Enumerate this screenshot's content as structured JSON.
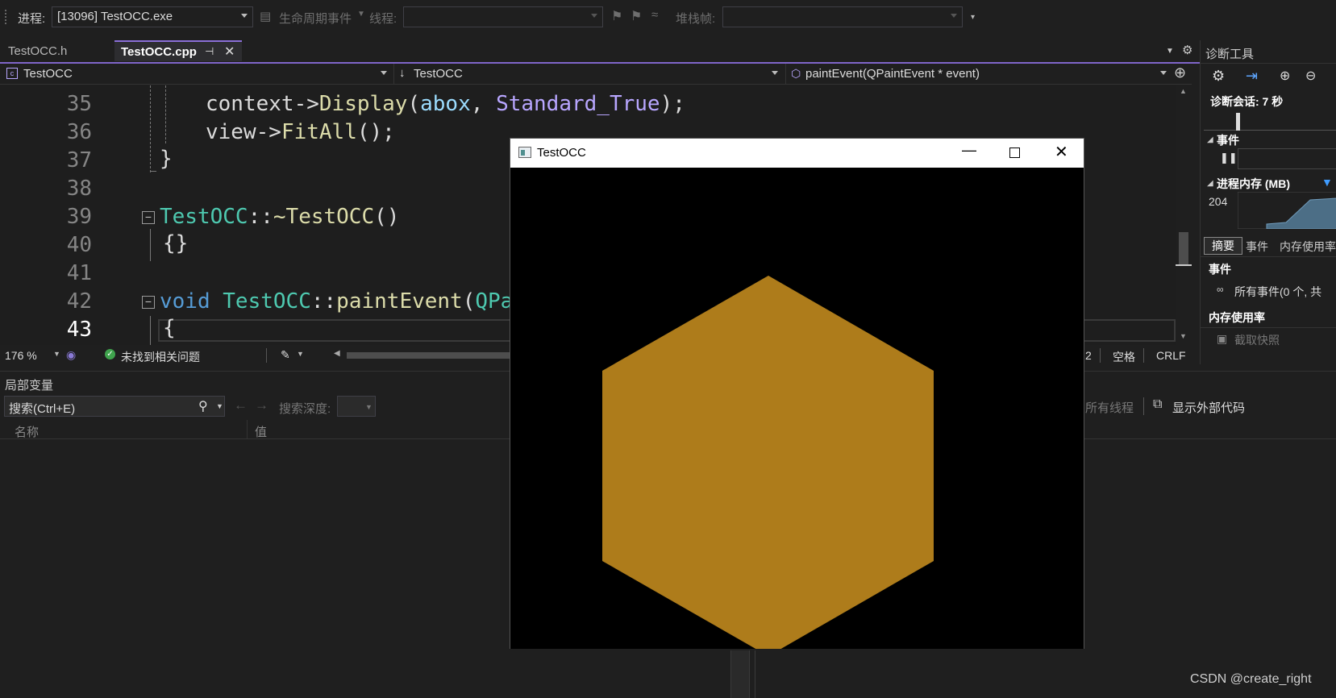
{
  "toolbar": {
    "process_label": "进程:",
    "process_value": "[13096] TestOCC.exe",
    "lifecycle_label": "生命周期事件",
    "thread_label": "线程:",
    "stackframe_label": "堆栈帧:"
  },
  "tabs": [
    {
      "label": "TestOCC.h"
    },
    {
      "label": "TestOCC.cpp"
    }
  ],
  "navbar": {
    "scope": "TestOCC",
    "member_scope": "TestOCC",
    "function": "paintEvent(QPaintEvent * event)"
  },
  "editor": {
    "lines": [
      {
        "num": "35",
        "text": "context->Display(abox, Standard_True);"
      },
      {
        "num": "36",
        "text": "view->FitAll();"
      },
      {
        "num": "37",
        "text": "}"
      },
      {
        "num": "38",
        "text": ""
      },
      {
        "num": "39",
        "text": "TestOCC::~TestOCC()"
      },
      {
        "num": "40",
        "text": "{}"
      },
      {
        "num": "41",
        "text": ""
      },
      {
        "num": "42",
        "text": "void TestOCC::paintEvent(QPaint"
      },
      {
        "num": "43",
        "text": "{"
      }
    ],
    "tokens": {
      "l35_a": "context",
      "l35_b": "->",
      "l35_c": "Display",
      "l35_d": "(",
      "l35_e": "abox",
      "l35_f": ", ",
      "l35_g": "Standard_True",
      "l35_h": ");",
      "l36_a": "view",
      "l36_b": "->",
      "l36_c": "FitAll",
      "l36_d": "();",
      "l39_a": "TestOCC",
      "l39_b": "::",
      "l39_c": "~TestOCC",
      "l39_d": "()",
      "l42_a": "void ",
      "l42_b": "TestOCC",
      "l42_c": "::",
      "l42_d": "paintEvent",
      "l42_e": "(",
      "l42_f": "QPaint"
    }
  },
  "edit_status": {
    "zoom": "176 %",
    "issues": "未找到相关问题",
    "col": "2",
    "indent": "空格",
    "line_ending": "CRLF"
  },
  "locals": {
    "title": "局部变量",
    "search_placeholder": "搜索(Ctrl+E)",
    "search_depth_label": "搜索深度:",
    "col_name": "名称",
    "col_value": "值",
    "all_threads": "所有线程",
    "show_external": "显示外部代码"
  },
  "diag": {
    "title": "诊断工具",
    "session": "诊断会话: 7 秒",
    "events_header": "事件",
    "memory_header": "进程内存 (MB)",
    "memory_value": "204",
    "tabs": [
      "摘要",
      "事件",
      "内存使用率"
    ],
    "events_section": "事件",
    "all_events": "所有事件(0 个, 共",
    "memory_usage": "内存使用率",
    "snapshot": "截取快照"
  },
  "app_window": {
    "title": "TestOCC",
    "hexagon_color": "#ae7c1b"
  },
  "watermark": "CSDN @create_right",
  "colors": {
    "accent": "#7f65c9",
    "background": "#1f1f1f",
    "editor_bg": "#1e1e1e"
  }
}
